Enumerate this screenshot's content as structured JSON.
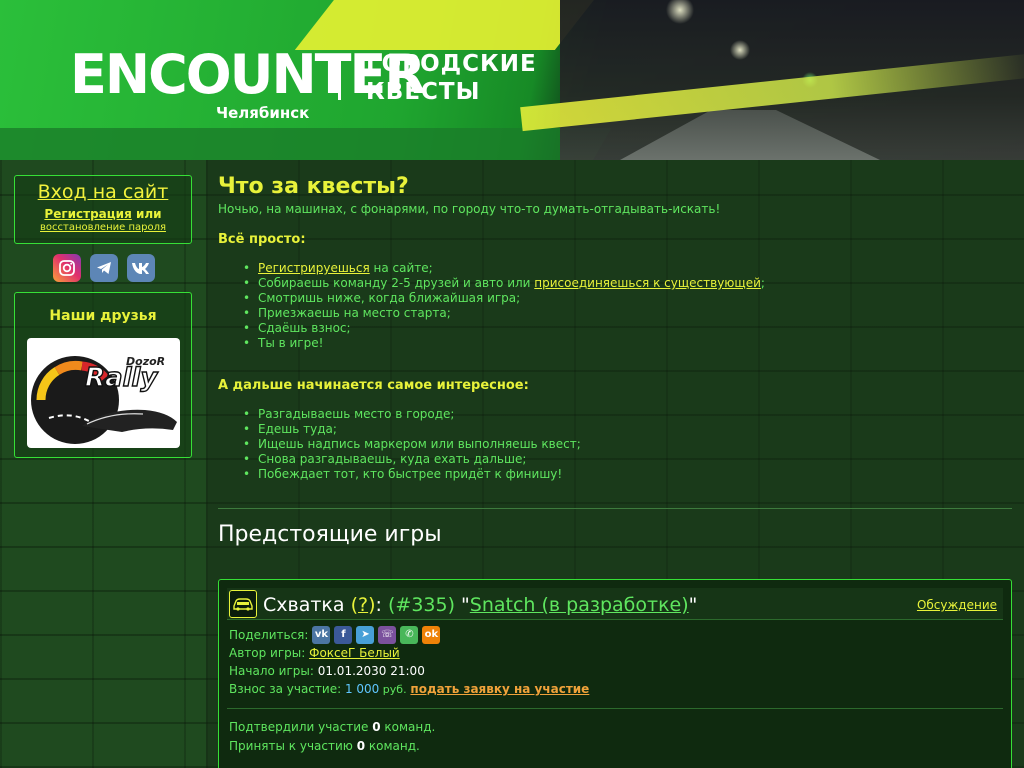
{
  "header": {
    "brand": "ENCOUNTER",
    "city": "Челябинск",
    "tagline_line1": "ГОРОДСКИЕ",
    "tagline_line2": "КВЕСТЫ"
  },
  "sidebar": {
    "login_title": "Вход на сайт",
    "register_label": "Регистрация",
    "or_label": " или",
    "restore_label": "восстановление пароля",
    "socials": [
      {
        "name": "instagram-icon"
      },
      {
        "name": "telegram-icon"
      },
      {
        "name": "vk-icon"
      }
    ],
    "friends_title": "Наши друзья",
    "friends_logo_top": "DozoR",
    "friends_logo_main": "Rally"
  },
  "intro": {
    "title": "Что за квесты?",
    "lead": "Ночью, на машинах, с фонарями, по городу что-то думать-отгадывать-искать!",
    "simple_heading": "Всё просто:",
    "steps": [
      {
        "link": "Регистрируешься",
        "text": " на сайте;"
      },
      {
        "pre": "Собираешь команду 2-5 друзей и авто или ",
        "link": "присоединяешься к существующей",
        "post": ";"
      },
      {
        "text": "Смотришь ниже, когда ближайшая игра;"
      },
      {
        "text": "Приезжаешь на место старта;"
      },
      {
        "text": "Сдаёшь взнос;"
      },
      {
        "text": "Ты в игре!"
      }
    ],
    "next_heading": "А дальше начинается самое интересное:",
    "next_steps": [
      "Разгадываешь место в городе;",
      "Едешь туда;",
      "Ищешь надпись маркером или выполняешь квест;",
      "Снова разгадываешь, куда ехать дальше;",
      "Побеждает тот, кто быстрее придёт к финишу!"
    ]
  },
  "upcoming": {
    "heading": "Предстоящие игры"
  },
  "game": {
    "type": "Схватка",
    "help": "?",
    "number": "(#335)",
    "name": "Snatch (в разработке)",
    "discuss": "Обсуждение",
    "share_label": "Поделиться:",
    "share_buttons": [
      "vk",
      "fb",
      "tg",
      "viber",
      "whatsapp",
      "ok"
    ],
    "author_label": "Автор игры:",
    "author": "ФоксеГ Белый",
    "start_label": "Начало игры:",
    "start": "01.01.2030 21:00",
    "fee_label": "Взнос за участие:",
    "fee_value": "1 000",
    "fee_currency": " руб.",
    "apply": "подать заявку на участие",
    "confirmed_pre": "Подтвердили участие ",
    "confirmed_count": "0",
    "confirmed_post": " команд.",
    "accepted_pre": "Приняты к участию ",
    "accepted_count": "0",
    "accepted_post": " команд."
  },
  "colors": {
    "accent_yellow": "#e8f23a",
    "text_green": "#5fe65f",
    "border_green": "#36e036",
    "apply_orange": "#f0a23a"
  }
}
